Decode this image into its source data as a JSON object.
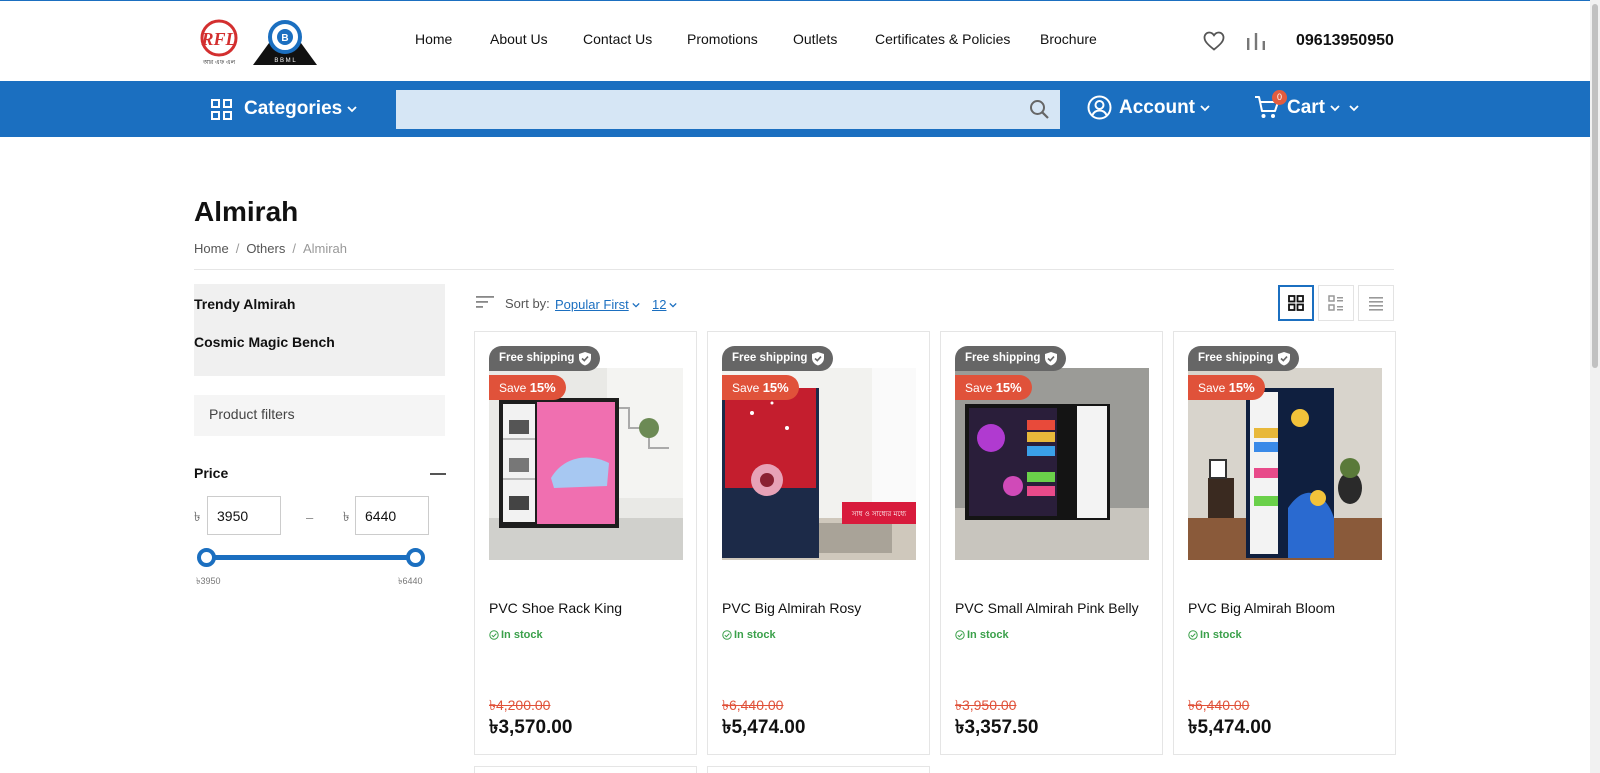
{
  "brand": {
    "logo_rfl_text": "RFL",
    "logo_rfl_sub": "আর এফ এল",
    "logo_bbml_text": "B",
    "logo_bbml_sub": "B B M L"
  },
  "nav": [
    {
      "label": "Home"
    },
    {
      "label": "About Us"
    },
    {
      "label": "Contact Us"
    },
    {
      "label": "Promotions"
    },
    {
      "label": "Outlets"
    },
    {
      "label": "Certificates & Policies"
    },
    {
      "label": "Brochure"
    }
  ],
  "header": {
    "phone": "09613950950",
    "wishlist_icon": "heart-icon",
    "compare_icon": "bar-chart-icon"
  },
  "bar": {
    "categories_label": "Categories",
    "search_placeholder": "",
    "account_label": "Account",
    "cart_label": "Cart",
    "cart_count": "0"
  },
  "page": {
    "title": "Almirah",
    "breadcrumb": [
      "Home",
      "Others",
      "Almirah"
    ]
  },
  "sidebar": {
    "subcategories": [
      "Trendy Almirah",
      "Cosmic Magic Bench"
    ],
    "filters_label": "Product filters",
    "price_heading": "Price",
    "currency": "৳",
    "price_min": "3950",
    "price_max": "6440",
    "price_sep": "–",
    "slider_min_label": "৳3950",
    "slider_max_label": "৳6440"
  },
  "toolbar": {
    "sort_label": "Sort by:",
    "sort_value": "Popular First",
    "per_page": "12",
    "view_modes": [
      "grid",
      "list-grid",
      "list"
    ],
    "active_view": "grid"
  },
  "products": [
    {
      "free_shipping": "Free shipping",
      "save_prefix": "Save",
      "save_pct": "15%",
      "name": "PVC Shoe Rack King",
      "stock": "In stock",
      "old_price": "৳4,200.00",
      "new_price": "৳3,570.00"
    },
    {
      "free_shipping": "Free shipping",
      "save_prefix": "Save",
      "save_pct": "15%",
      "name": "PVC Big Almirah Rosy",
      "stock": "In stock",
      "old_price": "৳6,440.00",
      "new_price": "৳5,474.00"
    },
    {
      "free_shipping": "Free shipping",
      "save_prefix": "Save",
      "save_pct": "15%",
      "name": "PVC Small Almirah Pink Belly",
      "stock": "In stock",
      "old_price": "৳3,950.00",
      "new_price": "৳3,357.50"
    },
    {
      "free_shipping": "Free shipping",
      "save_prefix": "Save",
      "save_pct": "15%",
      "name": "PVC Big Almirah Bloom",
      "stock": "In stock",
      "old_price": "৳6,440.00",
      "new_price": "৳5,474.00"
    }
  ],
  "colors": {
    "brand_blue": "#1b6fc0",
    "sale_red": "#e0523a",
    "stock_green": "#3aa04a",
    "search_bg": "#d6e6f5"
  }
}
